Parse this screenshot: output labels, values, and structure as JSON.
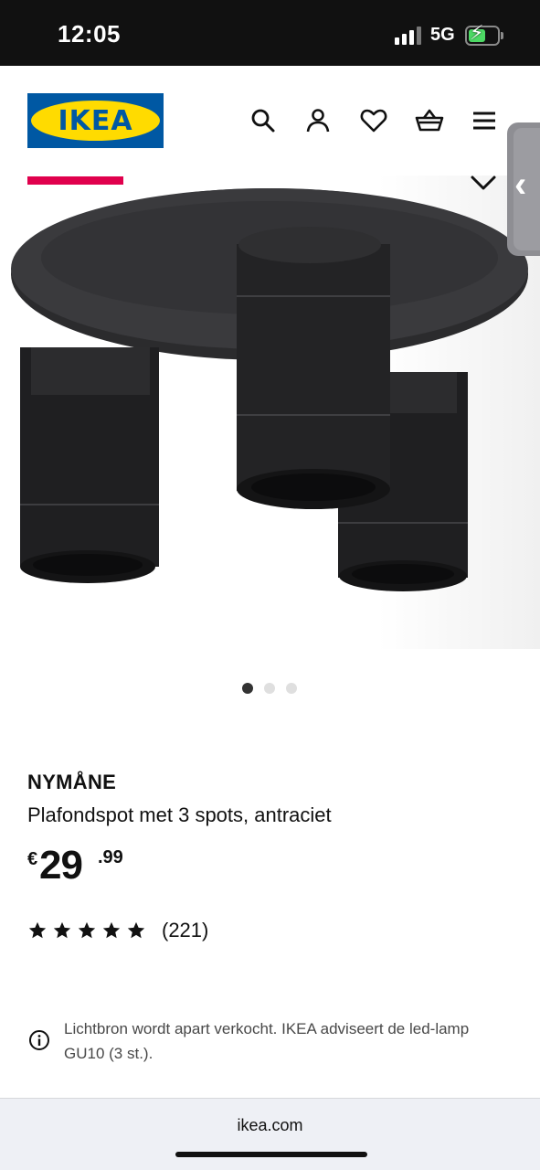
{
  "status_bar": {
    "time": "12:05",
    "network": "5G",
    "signal_bars": 3,
    "battery_level": 0.6,
    "charging": true
  },
  "header": {
    "logo_text": "IKEA",
    "icons": [
      "search-icon",
      "account-icon",
      "wishlist-heart-icon",
      "shopping-basket-icon",
      "menu-icon"
    ]
  },
  "gallery": {
    "image_count": 3,
    "active_index": 0
  },
  "product": {
    "brand": "NYMÅNE",
    "description": "Plafondspot met 3 spots, antraciet",
    "price_currency": "€",
    "price_integer": "29",
    "price_decimal": ".99",
    "rating_stars": 5,
    "rating_count": "(221)"
  },
  "notice": {
    "text": "Lichtbron wordt apart verkocht. IKEA adviseert de led-lamp GU10 (3 st.)."
  },
  "browser": {
    "url": "ikea.com"
  },
  "colors": {
    "ikea_blue": "#0058a3",
    "ikea_yellow": "#ffdb00",
    "promo_red": "#e0004d"
  }
}
